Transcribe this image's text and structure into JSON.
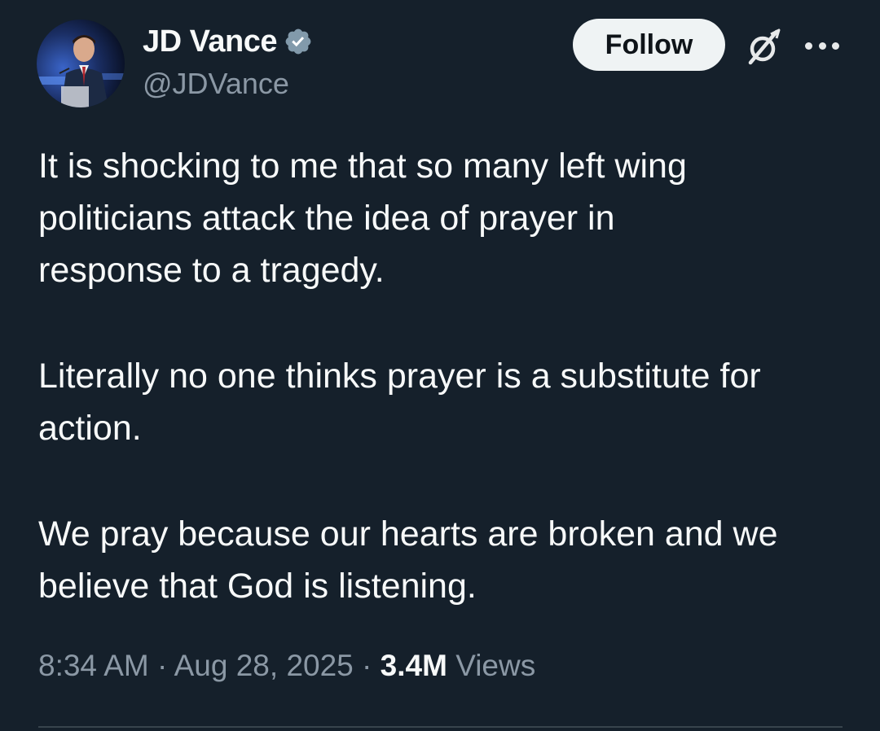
{
  "author": {
    "display_name": "JD Vance",
    "handle": "@JDVance",
    "verified": true,
    "verified_color": "#829aab"
  },
  "actions": {
    "follow_label": "Follow",
    "grok_icon": "grok-icon",
    "more_icon": "more-options-icon"
  },
  "tweet": {
    "paragraphs": [
      "It is shocking to me that so many left wing\npoliticians attack the idea of prayer in\nresponse to a tragedy.",
      "Literally no one thinks prayer is a substitute for\naction.",
      "We pray because our hearts are broken and we\nbelieve that God is listening."
    ]
  },
  "meta": {
    "time": "8:34 AM",
    "separator": " · ",
    "date": "Aug 28, 2025",
    "views_count": "3.4M",
    "views_label": "Views"
  },
  "colors": {
    "background": "#15202b",
    "text_primary": "#f7f9f9",
    "text_secondary": "#8b98a5",
    "follow_bg": "#eff3f4",
    "divider": "#38444d"
  }
}
